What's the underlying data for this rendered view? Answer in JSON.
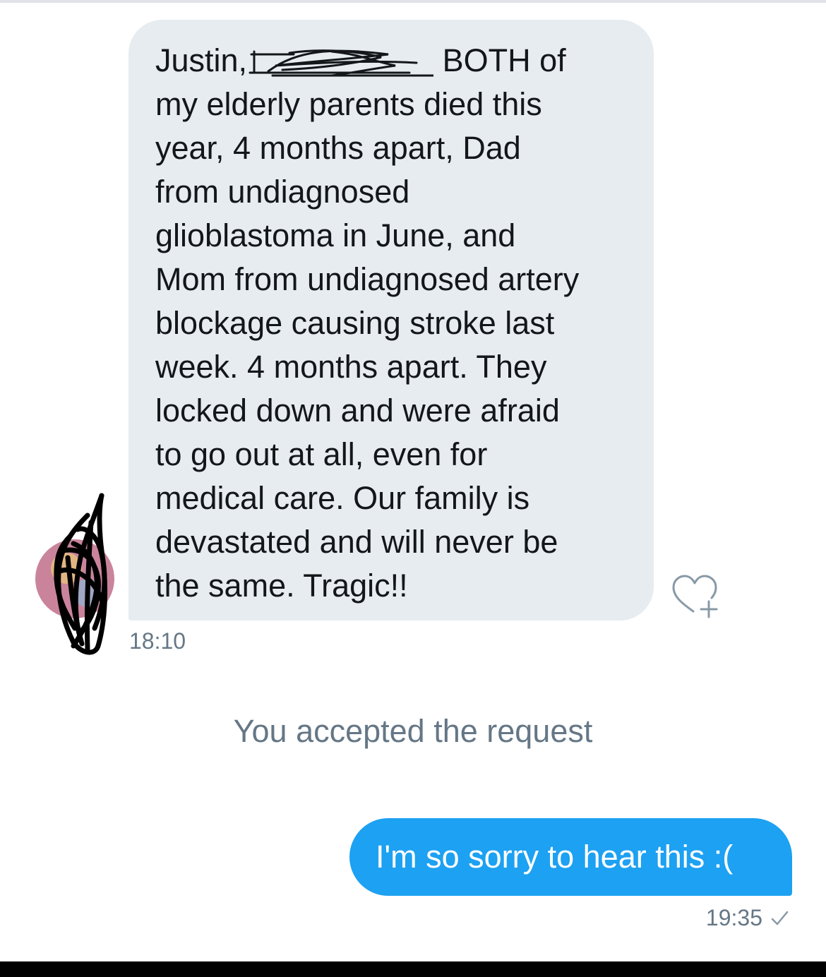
{
  "thread": {
    "incoming": {
      "lines": [
        "BOTH of",
        "my elderly parents died this",
        "year, 4 months apart, Dad",
        "from undiagnosed",
        "glioblastoma in June, and",
        "Mom from undiagnosed artery",
        "blockage causing stroke last",
        "week. 4 months apart. They",
        "locked down and were afraid",
        "to go out at all, even for",
        "medical care. Our family is",
        "devastated and will never be",
        "the same. Tragic!!"
      ],
      "greeting": "Justin,",
      "timestamp": "18:10"
    },
    "system_message": "You accepted the request",
    "outgoing": {
      "text": "I'm so sorry to hear this :(",
      "timestamp": "19:35"
    }
  },
  "colors": {
    "incoming_bubble": "#e6ecf0",
    "outgoing_bubble": "#1da1f2",
    "meta_text": "#657786",
    "body_text": "#14171a"
  },
  "icons": {
    "like": "heart-plus-icon",
    "status": "checkmark-icon"
  }
}
